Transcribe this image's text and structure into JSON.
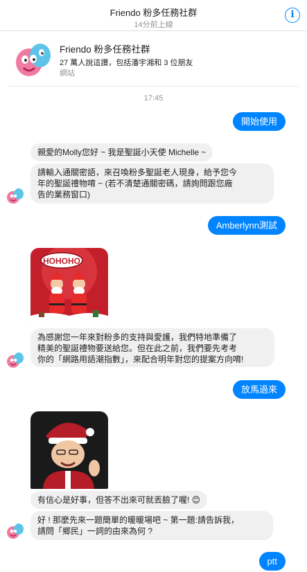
{
  "header": {
    "title": "Friendo 粉多任務社群",
    "status": "14分前上線",
    "info_icon": "i"
  },
  "page_card": {
    "name": "Friendo 粉多任務社群",
    "likes": "27 萬人說這讚，包括潘宇湘和 3 位朋友",
    "category": "網站"
  },
  "timestamp": "17:45",
  "messages": {
    "m1": "開始使用",
    "m2": "親愛的Molly您好 ~ 我是聖誕小天使 Michelle ~",
    "m3_line1": "請輸入通關密語，來召喚粉多聖誕老人現身，給予您今",
    "m3_line2": "年的聖誕禮物唷 ~ (若不清楚通關密碼，請詢問跟您廠",
    "m3_line3": "告的業務窗口)",
    "m4": "Amberlynn測試",
    "image1_text": "HOHOHO",
    "m5_line1": "為感謝您一年來對粉多的支持與愛護，我們特地準備了",
    "m5_line2": "精美的聖誕禮物要送給您。但在此之前，我們要先考考",
    "m5_line3": "你的「網路用語潮指數」，來配合明年對您的提案方向唷!",
    "m6": "放馬過來",
    "m7": "有信心是好事，但答不出來可就丟臉了喔! 😊",
    "m8_line1": "好 ! 那麼先來一題簡單的暖暖場吧 ~ 第一題:請告訴我，",
    "m8_line2": "請問「鄉民」一詞的由來為何 ?",
    "m9": "ptt"
  },
  "colors": {
    "accent": "#0084ff",
    "incoming_bubble": "#f1f0f0",
    "text_muted": "#90949c"
  }
}
